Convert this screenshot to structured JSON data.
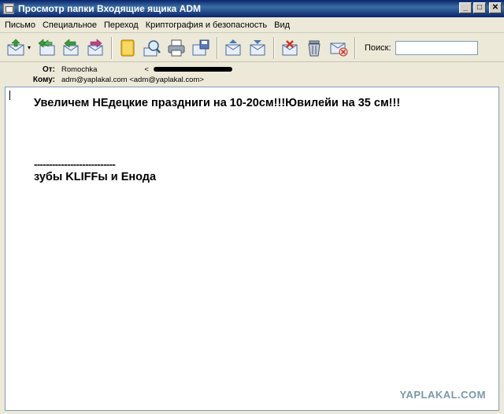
{
  "window": {
    "title": "Просмотр папки Входящие ящика ADM",
    "minimize": "_",
    "maximize": "□",
    "close": "✕"
  },
  "menu": [
    "Письмо",
    "Специальное",
    "Переход",
    "Криптография и безопасность",
    "Вид"
  ],
  "toolbar": {
    "buttons": [
      {
        "name": "get-mail-button",
        "icon": "mail-receive-icon"
      },
      {
        "name": "reply-all-button",
        "icon": "reply-all-icon"
      },
      {
        "name": "reply-button",
        "icon": "reply-icon"
      },
      {
        "name": "forward-button",
        "icon": "forward-icon"
      },
      {
        "name": "addressbook-button",
        "icon": "addressbook-icon"
      },
      {
        "name": "search-messages-button",
        "icon": "search-icon"
      },
      {
        "name": "print-button",
        "icon": "print-icon"
      },
      {
        "name": "save-button",
        "icon": "save-icon"
      },
      {
        "name": "previous-button",
        "icon": "previous-icon"
      },
      {
        "name": "next-button",
        "icon": "next-icon"
      },
      {
        "name": "mark-read-button",
        "icon": "mark-icon"
      },
      {
        "name": "delete-button",
        "icon": "trash-icon"
      },
      {
        "name": "junk-button",
        "icon": "junk-icon"
      }
    ],
    "dropdown_glyph": "▾",
    "search_label": "Поиск:",
    "search_value": ""
  },
  "header": {
    "from_label": "От:",
    "from_value": "Romochka",
    "from_email_start": "<",
    "to_label": "Кому:",
    "to_value": "adm@yaplakal.com <adm@yaplakal.com>"
  },
  "message": {
    "line1": "Увеличем НЕдецкие праздниги на 10-20см!!!Ювилейи на 35 см!!!",
    "dashes": "---------------------------",
    "line2": "зубы KLIFFы и Енода"
  },
  "watermark": "YAPLAKAL.COM",
  "colors": {
    "title_gradient": "#0a246a",
    "accent_green": "#3a9a3a",
    "accent_blue": "#4a78b8",
    "watermark": "#7b97a8"
  }
}
